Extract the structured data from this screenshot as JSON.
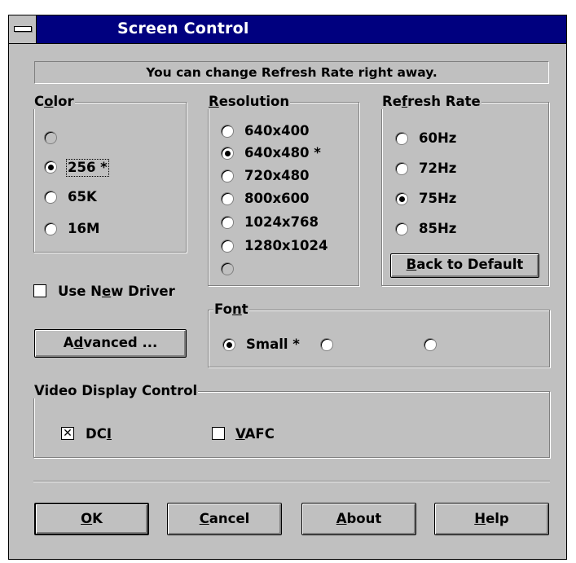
{
  "window": {
    "title": "Screen Control"
  },
  "status_message": "You can change Refresh Rate right away.",
  "color_group": {
    "label_pre": "C",
    "label_mn": "o",
    "label_post": "lor",
    "options": [
      {
        "label": "",
        "selected": false,
        "empty": true
      },
      {
        "label": "256 *",
        "selected": true
      },
      {
        "label": "65K",
        "selected": false
      },
      {
        "label": "16M",
        "selected": false
      }
    ]
  },
  "resolution_group": {
    "label_mn": "R",
    "label_post": "esolution",
    "options": [
      {
        "label": "640x400",
        "selected": false
      },
      {
        "label": "640x480 *",
        "selected": true
      },
      {
        "label": "720x480",
        "selected": false
      },
      {
        "label": "800x600",
        "selected": false
      },
      {
        "label": "1024x768",
        "selected": false
      },
      {
        "label": "1280x1024",
        "selected": false
      },
      {
        "label": "",
        "selected": false,
        "empty": true
      }
    ]
  },
  "refresh_group": {
    "label_pre": "Re",
    "label_mn": "f",
    "label_post": "resh Rate",
    "options": [
      {
        "label": "60Hz",
        "selected": false
      },
      {
        "label": "72Hz",
        "selected": false
      },
      {
        "label": "75Hz",
        "selected": true
      },
      {
        "label": "85Hz",
        "selected": false
      }
    ],
    "default_button": {
      "mn": "B",
      "post": "ack to Default"
    }
  },
  "use_new_driver": {
    "pre": "Use N",
    "mn": "e",
    "post": "w Driver",
    "checked": false
  },
  "advanced_button": {
    "pre": "A",
    "mn": "d",
    "post": "vanced ..."
  },
  "font_group": {
    "label_pre": "Fo",
    "label_mn": "n",
    "label_post": "t",
    "options": [
      {
        "label": "Small *",
        "selected": true
      },
      {
        "label": "",
        "selected": false,
        "empty": true
      },
      {
        "label": "",
        "selected": false,
        "empty": true
      }
    ]
  },
  "video_group": {
    "label": "Video Display Control",
    "dci": {
      "pre": "DC",
      "mn": "I",
      "checked": true,
      "mark": "✕"
    },
    "vafc": {
      "mn": "V",
      "post": "AFC",
      "checked": false
    }
  },
  "buttons": {
    "ok": {
      "mn": "O",
      "post": "K"
    },
    "cancel": {
      "mn": "C",
      "post": "ancel"
    },
    "about": {
      "mn": "A",
      "post": "bout"
    },
    "help": {
      "mn": "H",
      "post": "elp"
    }
  }
}
